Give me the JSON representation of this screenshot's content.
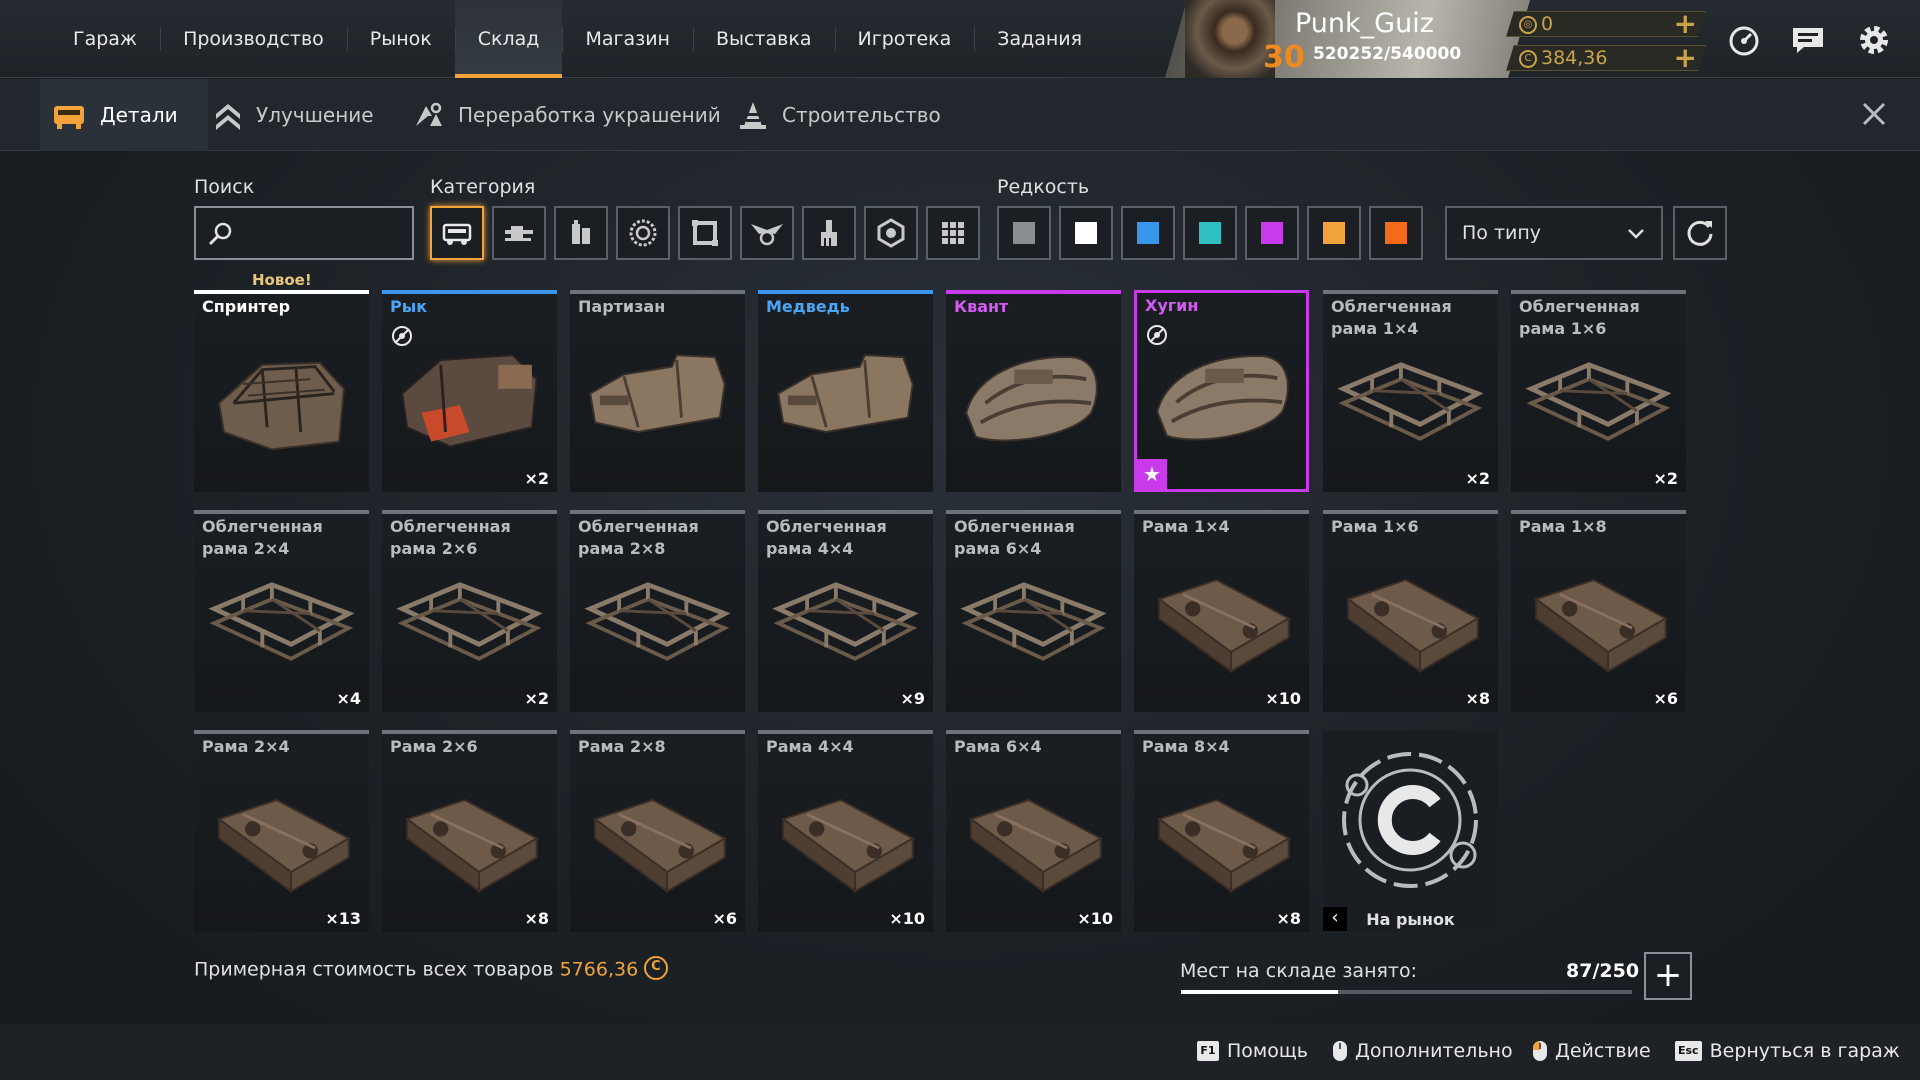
{
  "nav": {
    "items": [
      {
        "label": "Гараж",
        "active": false
      },
      {
        "label": "Производство",
        "active": false
      },
      {
        "label": "Рынок",
        "active": false
      },
      {
        "label": "Склад",
        "active": true
      },
      {
        "label": "Магазин",
        "active": false
      },
      {
        "label": "Выставка",
        "active": false
      },
      {
        "label": "Игротека",
        "active": false
      },
      {
        "label": "Задания",
        "active": false
      }
    ]
  },
  "player": {
    "name": "Punk_Guiz",
    "level": "30",
    "xp": "520252/540000"
  },
  "currency": {
    "coupons": "0",
    "coins": "384,36"
  },
  "subtabs": [
    {
      "label": "Детали",
      "icon": "parts-icon",
      "active": true
    },
    {
      "label": "Улучшение",
      "icon": "upgrade-icon",
      "active": false
    },
    {
      "label": "Переработка украшений",
      "icon": "recycle-icon",
      "active": false
    },
    {
      "label": "Строительство",
      "icon": "build-icon",
      "active": false
    }
  ],
  "filters": {
    "search_label": "Поиск",
    "search_value": "",
    "category_label": "Категория",
    "rarity_label": "Редкость",
    "sort_value": "По типу",
    "categories": [
      "cabin-icon",
      "weapon-icon",
      "module-icon",
      "wheel-icon",
      "frame-icon",
      "decor-icon",
      "paint-icon",
      "structure-icon",
      "misc-icon"
    ],
    "rarity_colors": [
      "#8a8d91",
      "#ffffff",
      "#3a96ea",
      "#2fc0c0",
      "#c83aea",
      "#f2a43a",
      "#f26a1a"
    ]
  },
  "new_badge": "Новое!",
  "items": [
    {
      "name": "Спринтер",
      "count": "",
      "rarity": "white",
      "kind": "cabin-open"
    },
    {
      "name": "Рык",
      "count": "×2",
      "rarity": "blue",
      "kind": "cabin-red",
      "no_trade": true
    },
    {
      "name": "Партизан",
      "count": "",
      "rarity": "grey",
      "kind": "cabin-truck"
    },
    {
      "name": "Медведь",
      "count": "",
      "rarity": "blue",
      "kind": "cabin-truck"
    },
    {
      "name": "Квант",
      "count": "",
      "rarity": "purple",
      "kind": "cabin-pod"
    },
    {
      "name": "Хугин",
      "count": "",
      "rarity": "purple",
      "kind": "cabin-pod",
      "no_trade": true,
      "selected": true,
      "favorite": true
    },
    {
      "name": "Облегченная рама 1×4",
      "count": "×2",
      "rarity": "grey",
      "kind": "frame-light"
    },
    {
      "name": "Облегченная рама 1×6",
      "count": "×2",
      "rarity": "grey",
      "kind": "frame-light"
    },
    {
      "name": "Облегченная рама 2×4",
      "count": "×4",
      "rarity": "grey",
      "kind": "frame-light"
    },
    {
      "name": "Облегченная рама 2×6",
      "count": "×2",
      "rarity": "grey",
      "kind": "frame-light"
    },
    {
      "name": "Облегченная рама 2×8",
      "count": "",
      "rarity": "grey",
      "kind": "frame-light"
    },
    {
      "name": "Облегченная рама 4×4",
      "count": "×9",
      "rarity": "grey",
      "kind": "frame-light"
    },
    {
      "name": "Облегченная рама 6×4",
      "count": "",
      "rarity": "grey",
      "kind": "frame-light"
    },
    {
      "name": "Рама 1×4",
      "count": "×10",
      "rarity": "grey",
      "kind": "frame-heavy"
    },
    {
      "name": "Рама 1×6",
      "count": "×8",
      "rarity": "grey",
      "kind": "frame-heavy"
    },
    {
      "name": "Рама 1×8",
      "count": "×6",
      "rarity": "grey",
      "kind": "frame-heavy"
    },
    {
      "name": "Рама 2×4",
      "count": "×13",
      "rarity": "grey",
      "kind": "frame-heavy"
    },
    {
      "name": "Рама 2×6",
      "count": "×8",
      "rarity": "grey",
      "kind": "frame-heavy"
    },
    {
      "name": "Рама 2×8",
      "count": "×6",
      "rarity": "grey",
      "kind": "frame-heavy"
    },
    {
      "name": "Рама 4×4",
      "count": "×10",
      "rarity": "grey",
      "kind": "frame-heavy"
    },
    {
      "name": "Рама 6×4",
      "count": "×10",
      "rarity": "grey",
      "kind": "frame-heavy"
    },
    {
      "name": "Рама 8×4",
      "count": "×8",
      "rarity": "grey",
      "kind": "frame-heavy"
    }
  ],
  "market_card": {
    "label": "На рынок"
  },
  "summary": {
    "total_label": "Примерная стоимость всех товаров",
    "total_value": "5766,36",
    "storage_label": "Мест на складе занято:",
    "storage_count": "87/250",
    "storage_fraction": 0.348
  },
  "footer": [
    {
      "key": "F1",
      "label": "Помощь"
    },
    {
      "key": "mouse-middle",
      "label": "Дополнительно"
    },
    {
      "key": "mouse-left",
      "label": "Действие"
    },
    {
      "key": "Esc",
      "label": "Вернуться в гараж"
    }
  ]
}
